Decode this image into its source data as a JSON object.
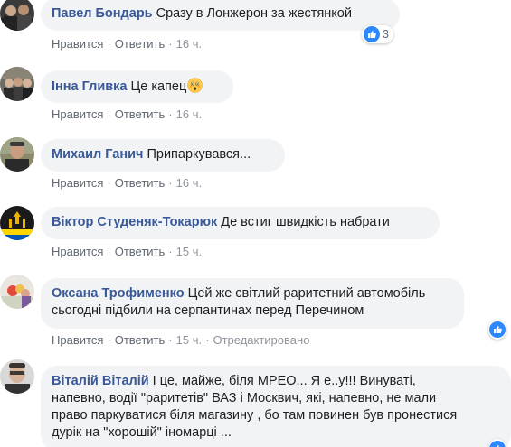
{
  "colors": {
    "author": "#385898",
    "bubble": "#f2f3f5",
    "action": "#606770",
    "like": "#2d88ff"
  },
  "comments": [
    {
      "author": "Павел Бондарь",
      "text": "Сразу в Лонжерон за жестянкой",
      "like_label": "Нравится",
      "reply_label": "Ответить",
      "time": "16 ч.",
      "reactions": {
        "icon": "like-icon",
        "count": "3"
      }
    },
    {
      "author": "Інна Гливка",
      "text": "Це капец",
      "emoji": "astonished-face-icon",
      "like_label": "Нравится",
      "reply_label": "Ответить",
      "time": "16 ч."
    },
    {
      "author": "Михаил Ганич",
      "text": "Припаркувався...",
      "like_label": "Нравится",
      "reply_label": "Ответить",
      "time": "16 ч."
    },
    {
      "author": "Віктор Студеняк-Токарюк",
      "text": "Де встиг швидкість набрати",
      "like_label": "Нравится",
      "reply_label": "Ответить",
      "time": "15 ч."
    },
    {
      "author": "Оксана Трофименко",
      "text_line1": "Цей же світлий раритетний автомобіль",
      "text_line2": "сьогодні підбили на серпантинах перед Перечином",
      "like_label": "Нравится",
      "reply_label": "Ответить",
      "time": "15 ч.",
      "edited_label": "Отредактировано",
      "reactions": {
        "icon": "like-icon"
      }
    },
    {
      "author": "Віталій Віталій",
      "text_line1": "І це, майже, біля МРЕО... Я е..у!!! Винуваті,",
      "text_line2": "напевно, водії \"раритетів\" ВАЗ і Москвич, які, напевно, не мали",
      "text_line3": "право паркуватися біля магазину , бо там повинен був пронестися",
      "text_line4": "дурік на \"хорошій\" іномарці ...",
      "reactions": {
        "icon": "like-icon"
      }
    }
  ]
}
